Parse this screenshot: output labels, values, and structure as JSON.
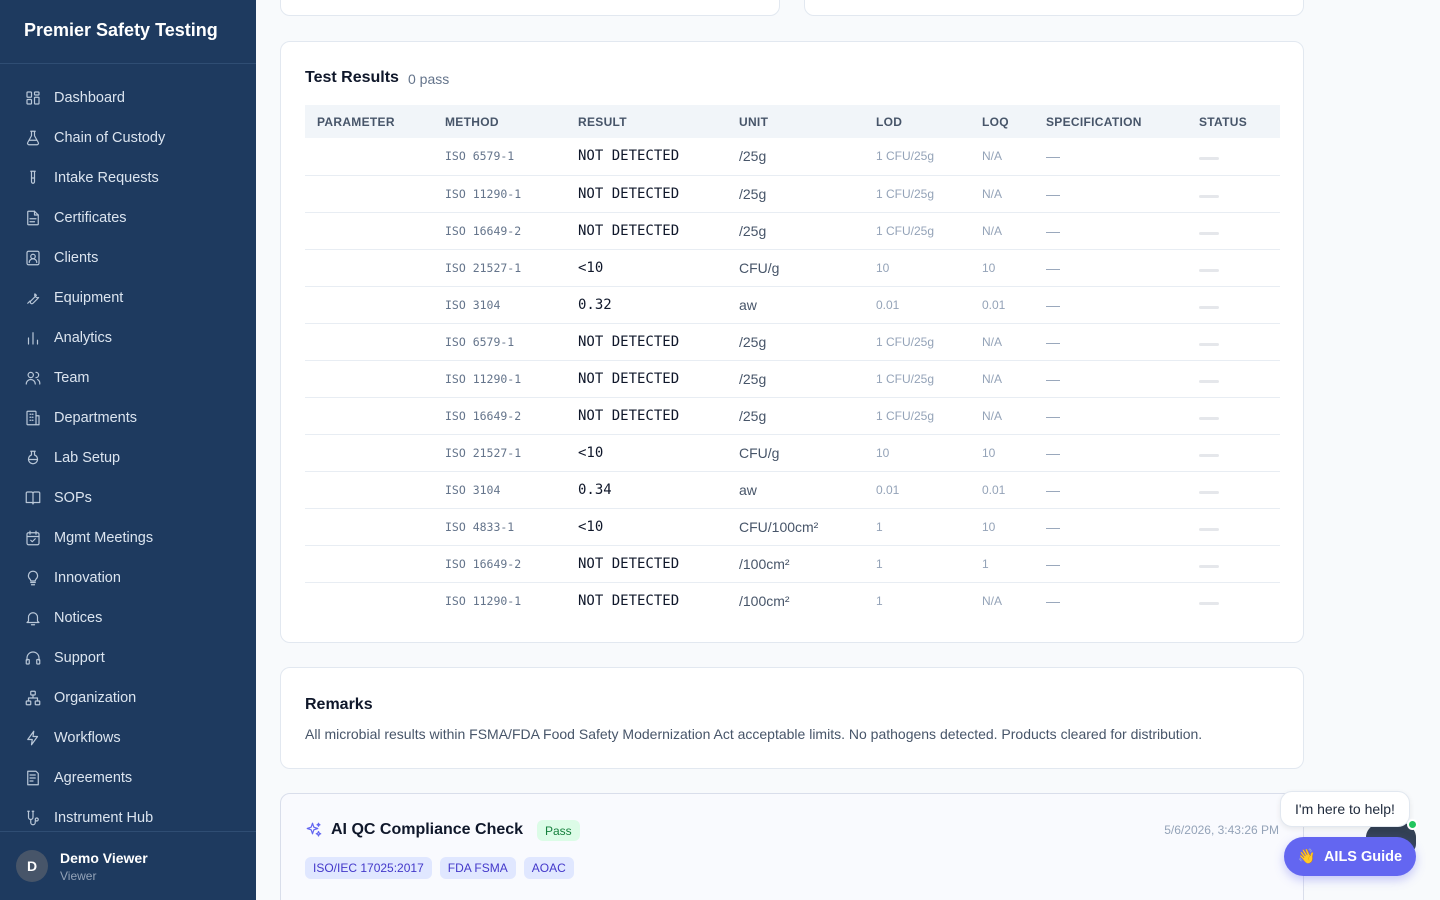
{
  "app": {
    "brand": "Premier Safety Testing"
  },
  "sidebar": {
    "items": [
      {
        "label": "Dashboard",
        "icon": "dashboard-icon"
      },
      {
        "label": "Chain of Custody",
        "icon": "flask-icon"
      },
      {
        "label": "Intake Requests",
        "icon": "test-tube-icon"
      },
      {
        "label": "Certificates",
        "icon": "document-icon"
      },
      {
        "label": "Clients",
        "icon": "contact-card-icon"
      },
      {
        "label": "Equipment",
        "icon": "wrench-icon"
      },
      {
        "label": "Analytics",
        "icon": "bar-chart-icon"
      },
      {
        "label": "Team",
        "icon": "users-icon"
      },
      {
        "label": "Departments",
        "icon": "building-icon"
      },
      {
        "label": "Lab Setup",
        "icon": "beaker-icon"
      },
      {
        "label": "SOPs",
        "icon": "book-icon"
      },
      {
        "label": "Mgmt Meetings",
        "icon": "calendar-icon"
      },
      {
        "label": "Innovation",
        "icon": "lightbulb-icon"
      },
      {
        "label": "Notices",
        "icon": "bell-icon"
      },
      {
        "label": "Support",
        "icon": "headset-icon"
      },
      {
        "label": "Organization",
        "icon": "org-chart-icon"
      },
      {
        "label": "Workflows",
        "icon": "lightning-icon"
      },
      {
        "label": "Agreements",
        "icon": "contract-icon"
      },
      {
        "label": "Instrument Hub",
        "icon": "instrument-icon"
      }
    ]
  },
  "user": {
    "initial": "D",
    "name": "Demo Viewer",
    "role": "Viewer"
  },
  "results": {
    "title": "Test Results",
    "summary": "0 pass",
    "columns": [
      "PARAMETER",
      "METHOD",
      "RESULT",
      "UNIT",
      "LOD",
      "LOQ",
      "SPECIFICATION",
      "STATUS"
    ],
    "rows": [
      {
        "parameter": "",
        "method": "ISO 6579-1",
        "result": "NOT DETECTED",
        "unit": "/25g",
        "lod": "1 CFU/25g",
        "loq": "N/A",
        "spec": "—"
      },
      {
        "parameter": "",
        "method": "ISO 11290-1",
        "result": "NOT DETECTED",
        "unit": "/25g",
        "lod": "1 CFU/25g",
        "loq": "N/A",
        "spec": "—"
      },
      {
        "parameter": "",
        "method": "ISO 16649-2",
        "result": "NOT DETECTED",
        "unit": "/25g",
        "lod": "1 CFU/25g",
        "loq": "N/A",
        "spec": "—"
      },
      {
        "parameter": "",
        "method": "ISO 21527-1",
        "result": "<10",
        "unit": "CFU/g",
        "lod": "10",
        "loq": "10",
        "spec": "—"
      },
      {
        "parameter": "",
        "method": "ISO 3104",
        "result": "0.32",
        "unit": "aw",
        "lod": "0.01",
        "loq": "0.01",
        "spec": "—"
      },
      {
        "parameter": "",
        "method": "ISO 6579-1",
        "result": "NOT DETECTED",
        "unit": "/25g",
        "lod": "1 CFU/25g",
        "loq": "N/A",
        "spec": "—"
      },
      {
        "parameter": "",
        "method": "ISO 11290-1",
        "result": "NOT DETECTED",
        "unit": "/25g",
        "lod": "1 CFU/25g",
        "loq": "N/A",
        "spec": "—"
      },
      {
        "parameter": "",
        "method": "ISO 16649-2",
        "result": "NOT DETECTED",
        "unit": "/25g",
        "lod": "1 CFU/25g",
        "loq": "N/A",
        "spec": "—"
      },
      {
        "parameter": "",
        "method": "ISO 21527-1",
        "result": "<10",
        "unit": "CFU/g",
        "lod": "10",
        "loq": "10",
        "spec": "—"
      },
      {
        "parameter": "",
        "method": "ISO 3104",
        "result": "0.34",
        "unit": "aw",
        "lod": "0.01",
        "loq": "0.01",
        "spec": "—"
      },
      {
        "parameter": "",
        "method": "ISO 4833-1",
        "result": "<10",
        "unit": "CFU/100cm²",
        "lod": "1",
        "loq": "10",
        "spec": "—"
      },
      {
        "parameter": "",
        "method": "ISO 16649-2",
        "result": "NOT DETECTED",
        "unit": "/100cm²",
        "lod": "1",
        "loq": "1",
        "spec": "—"
      },
      {
        "parameter": "",
        "method": "ISO 11290-1",
        "result": "NOT DETECTED",
        "unit": "/100cm²",
        "lod": "1",
        "loq": "N/A",
        "spec": "—"
      }
    ]
  },
  "remarks": {
    "title": "Remarks",
    "text": "All microbial results within FSMA/FDA Food Safety Modernization Act acceptable limits. No pathogens detected. Products cleared for distribution."
  },
  "qc": {
    "title": "AI QC Compliance Check",
    "badge": "Pass",
    "timestamp": "5/6/2026, 3:43:26 PM",
    "tags": [
      "ISO/IEC 17025:2017",
      "FDA FSMA",
      "AOAC"
    ],
    "icon": "sparkles-icon"
  },
  "help": {
    "bubble": "I'm here to help!",
    "button_emoji": "👋",
    "button_label": "AILS Guide"
  },
  "colors": {
    "sidebar_bg": "#1e3a5f",
    "accent": "#6366f1",
    "pass_bg": "#dcfce7",
    "pass_text": "#15803d"
  }
}
